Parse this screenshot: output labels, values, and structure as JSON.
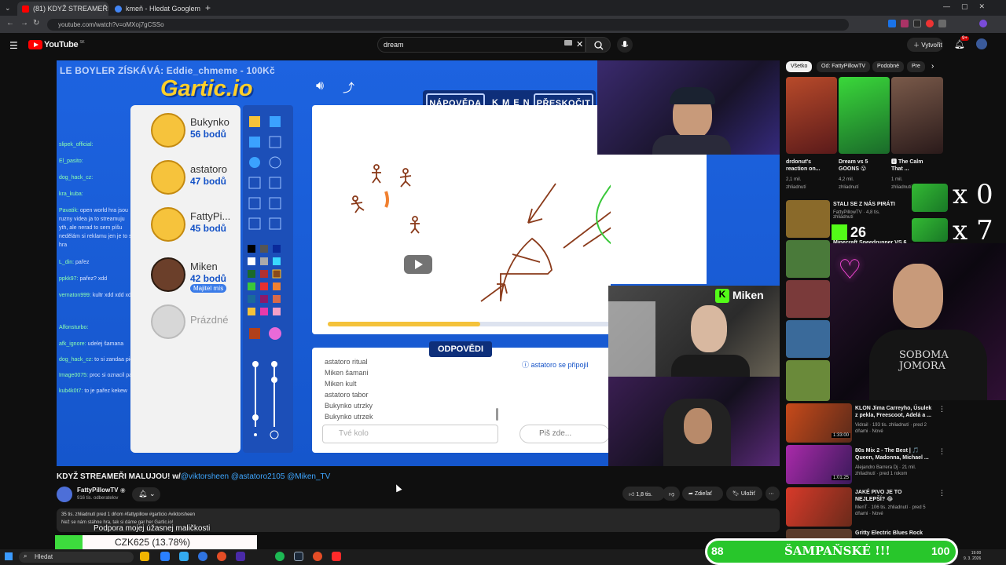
{
  "browser": {
    "tabs": [
      {
        "label": "(81) KDYŽ STREAMEŘI MALUJO",
        "active": true,
        "icon_color": "#ff0000"
      },
      {
        "label": "kmeň - Hledat Googlem",
        "active": false,
        "icon_color": "#4285f4"
      }
    ],
    "url": "youtube.com/watch?v=oMXoj7gCSSo",
    "new_tab": "+"
  },
  "youtube": {
    "logo_text": "YouTube",
    "logo_sup": "SK",
    "search_value": "dream",
    "create_label": "Vytvořit",
    "notif_count": "9+"
  },
  "video": {
    "overlay_banner": "LE BOYLER ZÍSKÁVÁ: Eddie_chmeme - 100Kč",
    "game_logo": "Gartic.io",
    "hint_buttons": [
      "NÁPOVĚDA",
      "K M E N",
      "PŘESKOČIT"
    ],
    "players": [
      {
        "name": "Bukynko",
        "points": "56 bodů"
      },
      {
        "name": "astatoro",
        "points": "47 bodů"
      },
      {
        "name": "FattyPi...",
        "points": "45 bodů"
      },
      {
        "name": "Miken",
        "points": "42 bodů",
        "badge": "Majitel mís"
      },
      {
        "name": "Prázdné",
        "points": ""
      }
    ],
    "answers_title": "ODPOVĚDI",
    "answers": [
      "astatoro ritual",
      "Miken šamani",
      "Miken kult",
      "astatoro tabor",
      "Bukynko utrzky",
      "Bukynko utrzek"
    ],
    "answer_placeholder": "Tvé kolo",
    "joined_notice": "astatoro se připojil",
    "chat_placeholder": "Piš zde...",
    "progress": 0.54,
    "streamer_badge": "Miken",
    "chat": [
      {
        "user": "slipek_official:",
        "msg": ""
      },
      {
        "user": "El_pasito:",
        "msg": ""
      },
      {
        "user": "dog_hack_cz:",
        "msg": ""
      },
      {
        "user": "kra_kuba:",
        "msg": ""
      },
      {
        "user": "Pavatik:",
        "msg": "open world hra jsou"
      },
      {
        "user": "",
        "msg": "ruzny videa ja to streamuju"
      },
      {
        "user": "",
        "msg": "yth, ale nerad to sem píšu"
      },
      {
        "user": "",
        "msg": "nedělám si reklamu jen je to super"
      },
      {
        "user": "",
        "msg": "hra"
      },
      {
        "user": "L_din:",
        "msg": "pařez"
      },
      {
        "user": "ppkk97:",
        "msg": "pařez? xdd"
      },
      {
        "user": "vernaton999:",
        "msg": "kultr xdd xdd xdd"
      },
      {
        "user": "Alfonsturbo:",
        "msg": ""
      },
      {
        "user": "afk_ignore:",
        "msg": "udelej šamana"
      },
      {
        "user": "dog_hack_cz:",
        "msg": "to si zandaa pico"
      },
      {
        "user": "Image0075:",
        "msg": "proc si oznacil pařez"
      },
      {
        "user": "kub4k0t7:",
        "msg": "to je pařez kekew"
      }
    ]
  },
  "below": {
    "title_prefix": "KDYŽ STREAMEŘI MALUJOU! w/",
    "title_links": "@viktorsheen @astatoro2105 @Miken_TV",
    "channel": "FattyPillowTV",
    "subs": "916 tis. odberatelov",
    "likes": "1,8 tis.",
    "share": "Zdieľať",
    "save": "Uložiť",
    "desc_line1": "35 tis. zhliadnutí  pred 1 dňom  #fattypillow #garticio #viktorsheen",
    "desc_line2": "Než se nám stáhne hra, tak si dáme gar her Gartic.io!",
    "support_text": "Podpora mojej úžasnej maličkosti",
    "goal_text": "CZK625 (13.78%)",
    "goal_progress": 0.1378
  },
  "sidebar": {
    "chips": [
      "Všetko",
      "Od: FattyPillowTV",
      "Podobné",
      "Pre"
    ],
    "top_videos": [
      {
        "title": "drdonut's reaction on...",
        "meta1": "2,1 mil.",
        "meta2": "zhliadnutí",
        "color": "#a83a2a"
      },
      {
        "title": "Dream vs 5 GOONS 😮",
        "meta1": "4,2 mil.",
        "meta2": "zhliadnutí",
        "color": "#2f9a3a"
      },
      {
        "title": "🅱 The Calm That ...",
        "meta1": "1 mil.",
        "meta2": "zhliadnutí",
        "color": "#6a4a3a"
      }
    ],
    "list": [
      {
        "title": "STALI SE Z NÁS PIRÁTI",
        "meta": "FattyPillowTV · 4,8 tis. zhliadnutí",
        "color": "#8a6a2a"
      },
      {
        "title": "Minecraft Speedrunner VS 6",
        "meta": "",
        "color": "#4a7a3a"
      },
      {
        "title": "",
        "meta": "",
        "color": "#7a3a3a"
      },
      {
        "title": "",
        "meta": "",
        "color": "#3a6a9a"
      },
      {
        "title": "",
        "meta": "",
        "color": "#6a8a3a"
      },
      {
        "title": "KLON Jima Carreyho, Úsulek z pekla, Freescoot, Adelá a ...",
        "meta": "Vidrail · 193 tis. zhliadnutí · pred 2 dňami · Nové",
        "color": "#a85a2a",
        "duration": "1:33:00"
      },
      {
        "title": "80s Mix 2 - The Best | 🎵 Queen, Madonna, Michael ...",
        "meta": "Alejandro Barrera Dj · 21 mil. zhliadnutí · pred 1 rokom",
        "color": "#8a2a8a",
        "duration": "1:01:25"
      },
      {
        "title": "JAKÉ PIVO JE TO NEJLEPŠÍ? 😂",
        "meta": "MenT · 106 tis. zhliadnutí · pred 5 dňami · Nové",
        "color": "#c83a2a"
      },
      {
        "title": "Gritty Electric Blues Rock",
        "meta": "",
        "color": "#5a3a2a"
      }
    ],
    "overlay_x0": "x 0",
    "overlay_x7": "x 7",
    "overlay_26": "26",
    "webcam_text": "SOBOMA JOMORA"
  },
  "taskbar": {
    "search": "Hledat",
    "clock_time": "19:00",
    "clock_date": "9. 3. 2026",
    "icons": [
      "#f0b400",
      "#2a7fff",
      "#33aaee",
      "#2f73e0",
      "#e44d26",
      "#4a2aa8",
      "#1db954",
      "#1b2838",
      "#e44d26",
      "#ff2a2a"
    ]
  },
  "alert": {
    "left_num": "88",
    "text": "ŠAMPAŇSKÉ !!!",
    "right_num": "100"
  }
}
